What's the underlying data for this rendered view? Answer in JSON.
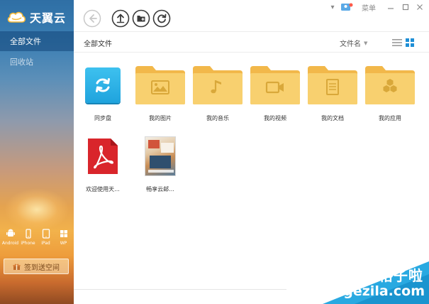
{
  "app": {
    "name": "天翼云"
  },
  "sidebar": {
    "items": [
      {
        "label": "全部文件",
        "active": true
      },
      {
        "label": "回收站",
        "active": false
      }
    ],
    "platforms": [
      {
        "label": "Android",
        "icon": "android-icon"
      },
      {
        "label": "iPhone",
        "icon": "iphone-icon"
      },
      {
        "label": "iPad",
        "icon": "ipad-icon"
      },
      {
        "label": "WP",
        "icon": "windows-phone-icon"
      }
    ],
    "sign_in_button": "签到送空间"
  },
  "toolbar": {
    "buttons": [
      "back-icon",
      "upload-icon",
      "new-folder-icon",
      "refresh-icon"
    ],
    "window": {
      "menu_label": "菜单"
    }
  },
  "breadcrumb": {
    "current": "全部文件"
  },
  "sort": {
    "label": "文件名"
  },
  "view_mode": "grid",
  "files": [
    {
      "name": "同步盘",
      "type": "sync-folder",
      "icon": "sync-icon"
    },
    {
      "name": "我的图片",
      "type": "folder",
      "icon": "image-icon"
    },
    {
      "name": "我的音乐",
      "type": "folder",
      "icon": "music-note-icon"
    },
    {
      "name": "我的视频",
      "type": "folder",
      "icon": "video-icon"
    },
    {
      "name": "我的文档",
      "type": "folder",
      "icon": "document-icon"
    },
    {
      "name": "我的应用",
      "type": "folder",
      "icon": "app-hexagons-icon"
    },
    {
      "name": "欢迎使用天...",
      "type": "pdf",
      "icon": "pdf-icon"
    },
    {
      "name": "畅享云邮...",
      "type": "image",
      "icon": "image-thumbnail"
    }
  ],
  "watermark": {
    "cn": "格子啦",
    "en": "gezila.com"
  },
  "colors": {
    "accent": "#1fa3dd",
    "folder": "#f6c55c",
    "sidebar_active": "#1c5d96"
  }
}
